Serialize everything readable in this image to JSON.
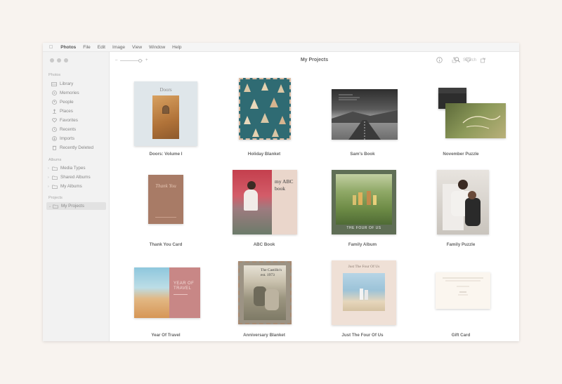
{
  "menubar": {
    "items": [
      "Photos",
      "File",
      "Edit",
      "Image",
      "View",
      "Window",
      "Help"
    ]
  },
  "sidebar": {
    "sections": [
      {
        "title": "Photos",
        "items": [
          {
            "label": "Library",
            "icon": "library-icon"
          },
          {
            "label": "Memories",
            "icon": "memories-icon"
          },
          {
            "label": "People",
            "icon": "people-icon"
          },
          {
            "label": "Places",
            "icon": "places-icon"
          },
          {
            "label": "Favorites",
            "icon": "heart-icon"
          },
          {
            "label": "Recents",
            "icon": "clock-icon"
          },
          {
            "label": "Imports",
            "icon": "import-icon"
          },
          {
            "label": "Recently Deleted",
            "icon": "trash-icon"
          }
        ]
      },
      {
        "title": "Albums",
        "items": [
          {
            "label": "Media Types",
            "icon": "folder-icon"
          },
          {
            "label": "Shared Albums",
            "icon": "shared-folder-icon"
          },
          {
            "label": "My Albums",
            "icon": "folder-icon"
          }
        ]
      },
      {
        "title": "Projects",
        "items": [
          {
            "label": "My Projects",
            "icon": "folder-icon",
            "selected": true
          }
        ]
      }
    ]
  },
  "toolbar": {
    "title": "My Projects",
    "zoom_minus": "–",
    "zoom_plus": "+",
    "search_placeholder": "Search"
  },
  "projects": [
    {
      "caption": "Doors: Volume I",
      "cover_title": "Doors"
    },
    {
      "caption": "Holiday Blanket"
    },
    {
      "caption": "Sam's Book"
    },
    {
      "caption": "November Puzzle"
    },
    {
      "caption": "Thank You Card",
      "cover_title": "Thank You"
    },
    {
      "caption": "ABC Book",
      "cover_title": "my ABC book"
    },
    {
      "caption": "Family Album",
      "cover_title": "THE FOUR OF US"
    },
    {
      "caption": "Family Puzzle"
    },
    {
      "caption": "Year Of Travel",
      "cover_title": "YEAR OF TRAVEL"
    },
    {
      "caption": "Anniversary Blanket",
      "cover_title": "The Castillo's est. 1973"
    },
    {
      "caption": "Just The Four Of Us",
      "cover_title": "Just The Four Of Us"
    },
    {
      "caption": "Gift Card"
    }
  ],
  "colors": {
    "background": "#f8f3ef",
    "sidebar": "#f2f2f2",
    "accent_brown": "#a87b66"
  }
}
